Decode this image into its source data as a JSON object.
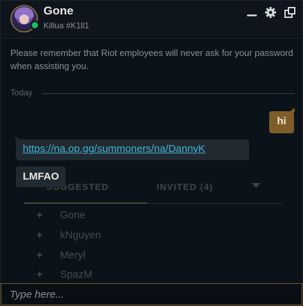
{
  "header": {
    "name": "Gone",
    "tag": "Killua #K1ll1",
    "status_color": "#11c25b",
    "controls": [
      "minimize-icon",
      "gear-icon",
      "popout-icon"
    ]
  },
  "notice": "Please remember that Riot employees will never ask for your password when assisting you.",
  "divider": {
    "label": "Today"
  },
  "messages": {
    "outgoing": {
      "text": "hi"
    },
    "incoming_link": {
      "text": "https://na.op.gg/summoners/na/DannyK"
    },
    "incoming_text": {
      "text": "LMFAO"
    }
  },
  "background_panel": {
    "tabs": {
      "suggested": "SUGGESTED",
      "invited": "INVITED (4)"
    },
    "items": [
      "Gone",
      "kNguyen",
      "Meryl",
      "SpazM"
    ]
  },
  "input": {
    "placeholder": "Type here..."
  },
  "colors": {
    "accent_gold": "#c8aa6e",
    "outgoing_bubble": "#7e5d28",
    "incoming_bubble": "#222a31",
    "link": "#3eb6d6"
  }
}
